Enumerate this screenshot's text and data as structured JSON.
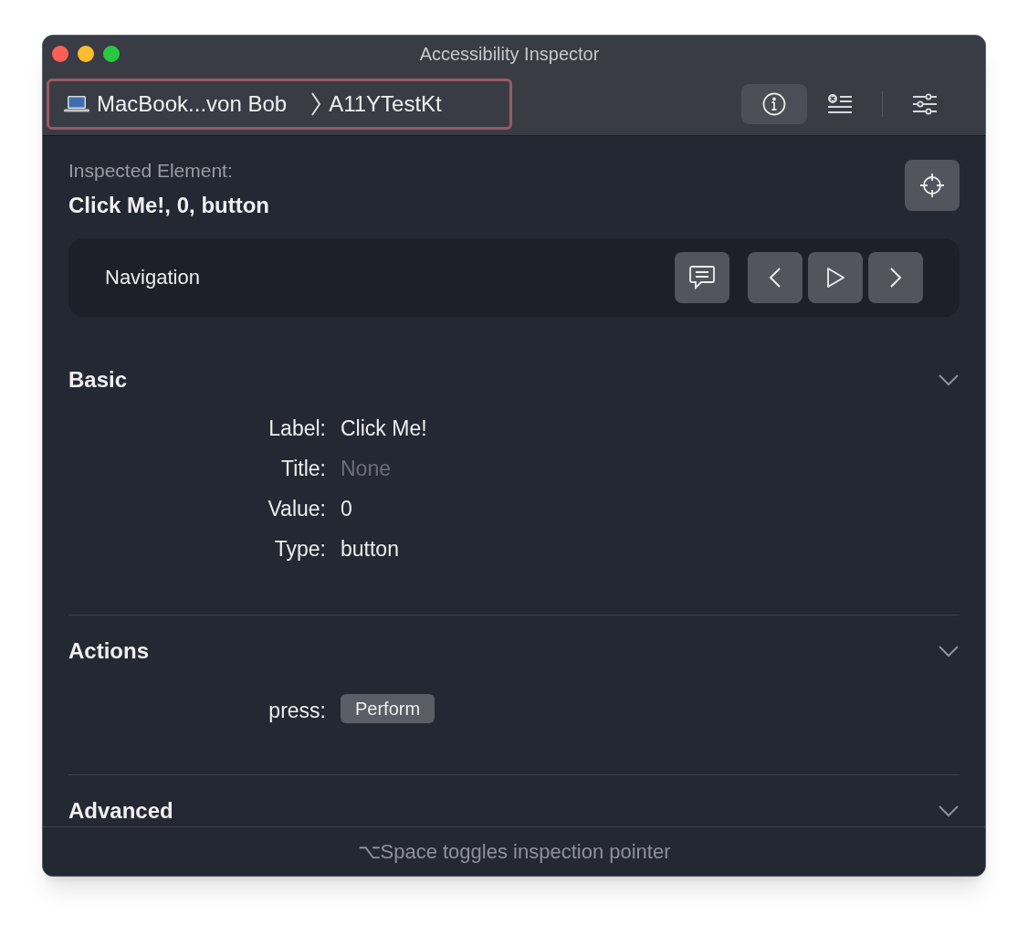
{
  "window": {
    "title": "Accessibility Inspector"
  },
  "toolbar": {
    "breadcrumb": [
      {
        "kind": "device",
        "label": "MacBook...von Bob"
      },
      {
        "kind": "app",
        "label": "A11YTestKt"
      }
    ],
    "buttons": [
      {
        "kind": "info",
        "selected": true
      },
      {
        "kind": "clear",
        "selected": false
      },
      {
        "kind": "settings",
        "selected": false
      }
    ]
  },
  "inspected": {
    "caption": "Inspected Element:",
    "value": "Click Me!, 0, button"
  },
  "navigation": {
    "label": "Navigation"
  },
  "sections": [
    {
      "title": "Basic",
      "rows": [
        {
          "label": "Label:",
          "value": "Click Me!",
          "dimmed": false
        },
        {
          "label": "Title:",
          "value": "None",
          "dimmed": true
        },
        {
          "label": "Value:",
          "value": "0",
          "dimmed": false
        },
        {
          "label": "Type:",
          "value": "button",
          "dimmed": false
        }
      ]
    },
    {
      "title": "Actions",
      "actions": [
        {
          "label": "press:",
          "button": "Perform"
        }
      ]
    },
    {
      "title": "Advanced"
    }
  ],
  "footer": "⌥Space toggles inspection pointer"
}
